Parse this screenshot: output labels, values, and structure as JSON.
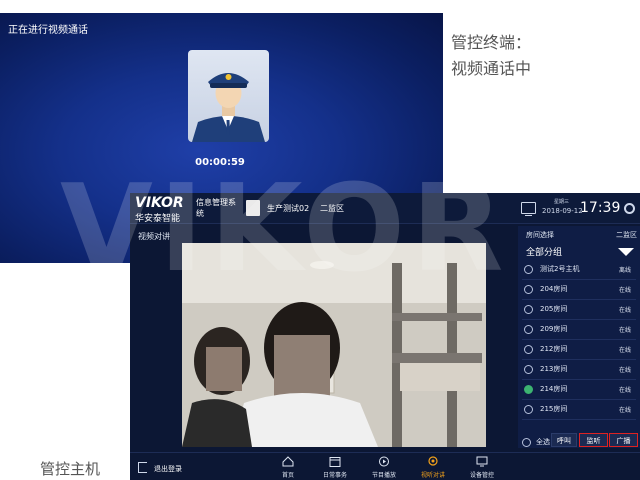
{
  "terminal": {
    "title": "正在进行视频通话",
    "timer": "00:00:59"
  },
  "captions": {
    "terminal_line1": "管控终端：",
    "terminal_line2": "视频通话中",
    "host": "管控主机"
  },
  "host": {
    "logo_main": "VIKOR",
    "logo_sub": "华安泰智能",
    "system_name": "信息管理系统",
    "user_name": "生产测试02",
    "area_name": "二监区",
    "weekday": "星期三",
    "date": "2018-09-12",
    "time": "17:39",
    "section_label": "视频对讲",
    "panel": {
      "title": "房间选择",
      "area": "二监区",
      "group_selected": "全部分组",
      "rooms": [
        {
          "name": "测试2号主机",
          "status": "离线",
          "checked": false
        },
        {
          "name": "204房间",
          "status": "在线",
          "checked": false
        },
        {
          "name": "205房间",
          "status": "在线",
          "checked": false
        },
        {
          "name": "209房间",
          "status": "在线",
          "checked": false
        },
        {
          "name": "212房间",
          "status": "在线",
          "checked": false
        },
        {
          "name": "213房间",
          "status": "在线",
          "checked": false
        },
        {
          "name": "214房间",
          "status": "在线",
          "checked": true
        },
        {
          "name": "215房间",
          "status": "在线",
          "checked": false
        }
      ],
      "select_all": "全选",
      "btn_call": "呼叫",
      "btn_listen": "监听",
      "btn_broadcast": "广播"
    },
    "logout_label": "退出登录",
    "nav": [
      {
        "label": "首页",
        "icon": "home-icon",
        "active": false
      },
      {
        "label": "日常事务",
        "icon": "calendar-icon",
        "active": false
      },
      {
        "label": "节目播放",
        "icon": "play-icon",
        "active": false
      },
      {
        "label": "视听对讲",
        "icon": "intercom-icon",
        "active": true
      },
      {
        "label": "设备管控",
        "icon": "device-icon",
        "active": false
      }
    ]
  },
  "watermark": "VIKOR",
  "colors": {
    "active_nav": "#f3a21b",
    "highlight_border": "#dd2222",
    "checked_radio": "#3cb371"
  }
}
